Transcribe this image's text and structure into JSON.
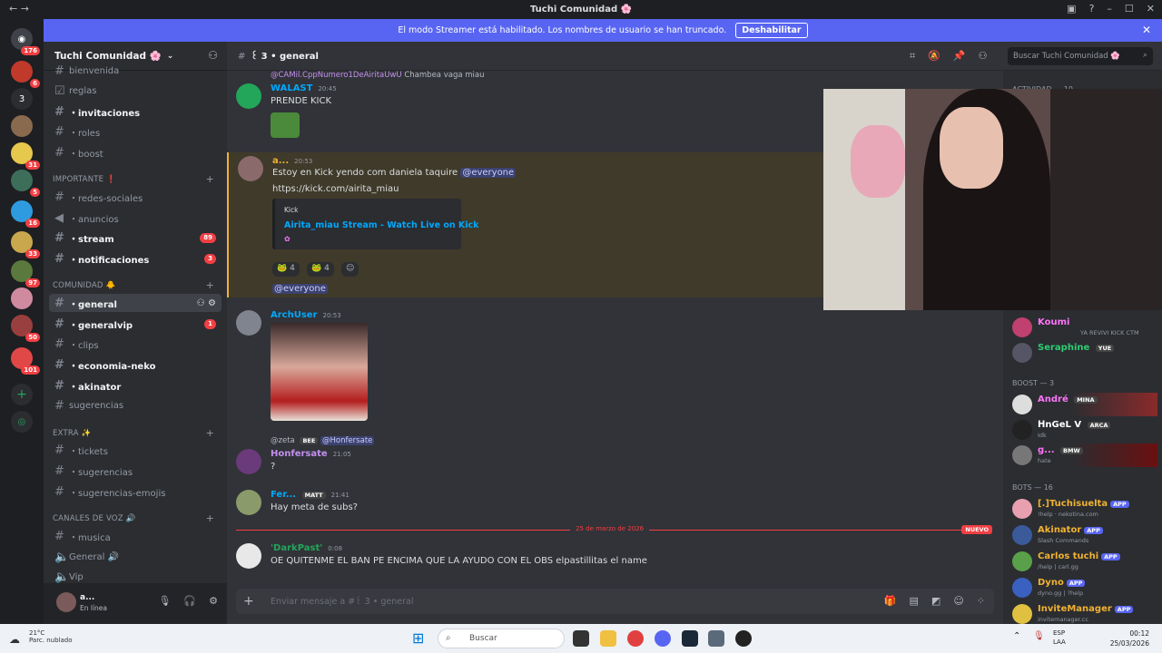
{
  "window": {
    "title": "Tuchi Comunidad 🌸"
  },
  "streamer_bar": {
    "message": "El modo Streamer está habilitado. Los nombres de usuario se han truncado.",
    "button": "Deshabilitar"
  },
  "guilds": [
    {
      "label": "",
      "badge": "176"
    },
    {
      "label": "",
      "badge": "6"
    },
    {
      "label": "3",
      "badge": ""
    },
    {
      "label": "",
      "badge": ""
    },
    {
      "label": "",
      "badge": "31"
    },
    {
      "label": "",
      "badge": "5"
    },
    {
      "label": "",
      "badge": "16"
    },
    {
      "label": "",
      "badge": "33"
    },
    {
      "label": "",
      "badge": "97"
    },
    {
      "label": "",
      "badge": ""
    },
    {
      "label": "",
      "badge": "50"
    },
    {
      "label": "",
      "badge": "101"
    }
  ],
  "server": {
    "name": "Tuchi Comunidad 🌸"
  },
  "channels": {
    "bienvenida": "bienvenida",
    "reglas": "reglas",
    "invitaciones": "・invitaciones",
    "roles": "・roles",
    "boost": "・boost",
    "cat_importante": "IMPORTANTE ❗",
    "redes_sociales": "・redes-sociales",
    "anuncios": "・anuncios",
    "stream": "・stream",
    "stream_badge": "89",
    "notificaciones": "・notificaciones",
    "notificaciones_badge": "3",
    "cat_comunidad": "COMUNIDAD 🐥",
    "general": "・general",
    "generalvip": "・generalvip",
    "generalvip_badge": "1",
    "clips": "・clips",
    "economia": "・economia-neko",
    "akinator": "・akinator",
    "sugerencias_plain": "sugerencias",
    "cat_extra": "EXTRA ✨",
    "tickets": "・tickets",
    "sugerencias": "・sugerencias",
    "sugerencias_emojis": "・sugerencias-emojis",
    "cat_voz": "CANALES DE VOZ 🔊",
    "musica": "・musica",
    "general_voice": "General 🔊",
    "vip": "Vip"
  },
  "user": {
    "name": "a...",
    "status": "En línea"
  },
  "header": {
    "channel": "꒰ 3 • general",
    "search_placeholder": "Buscar Tuchi Comunidad 🌸"
  },
  "messages": [
    {
      "reply_author": "@CAMil.CppNumero1DeAiritaUwU",
      "reply_text": "Chambea vaga miau",
      "author": "WALAST",
      "time": "20:45",
      "text": "PRENDE KICK"
    },
    {
      "author": "a...",
      "time": "20:53",
      "text": "Estoy en Kick yendo com daniela taquire",
      "mention": "@everyone",
      "link": "https://kick.com/airita_miau",
      "embed_provider": "Kick",
      "embed_title": "Airita_miau Stream - Watch Live on Kick",
      "react1": "4",
      "react2": "4",
      "followup": "@everyone"
    },
    {
      "author": "ArchUser",
      "time": "20:53"
    },
    {
      "reply_author": "@zeta",
      "reply_tag": "BEE",
      "reply_mention": "@Honfersate",
      "author": "Honfersate",
      "time": "21:05",
      "text": "?"
    },
    {
      "author": "Fer...",
      "tag": "MATT",
      "time": "21:41",
      "text": "Hay meta de subs?"
    },
    {
      "author": "'DarkPast'",
      "time": "0:08",
      "text": "OE QUITENME EL BAN PE ENCIMA QUE LA AYUDO CON EL OBS elpastillitas el name"
    }
  ],
  "divider": {
    "date": "25 de marzo de 2026",
    "new_label": "NUEVO"
  },
  "composer": {
    "placeholder": "Enviar mensaje a #꒰ 3 • general"
  },
  "members": {
    "activity": "Actividad — 10",
    "online": [
      {
        "name": "Koumi",
        "status": "YA REVIVI KICK CTM",
        "color": "#ff73fa"
      },
      {
        "name": "Seraphine",
        "status": "",
        "color": "#2ecc71",
        "tag": "YUE"
      }
    ],
    "boost_label": "BOOST — 3",
    "boost": [
      {
        "name": "André",
        "tag": "MINA",
        "status": "",
        "color": "#ff73fa"
      },
      {
        "name": "ᕼnGeL V",
        "tag": "ARCA",
        "status": "Idk",
        "color": "#ffffff"
      },
      {
        "name": "g...",
        "tag": "BMW",
        "status": "hate",
        "color": "#ff73fa"
      }
    ],
    "bots_label": "BOTS — 16",
    "bots": [
      {
        "name": "[.]Tuchisuelta",
        "tag": "APP",
        "status": "!help · nekotina.com",
        "color": "#f0b232"
      },
      {
        "name": "Akinator",
        "tag": "APP",
        "status": "Slash Commands",
        "color": "#f0b232"
      },
      {
        "name": "Carlos tuchi",
        "tag": "APP",
        "status": "/help | carl.gg",
        "color": "#f0b232"
      },
      {
        "name": "Dyno",
        "tag": "APP",
        "status": "dyno.gg | ?help",
        "color": "#f0b232"
      },
      {
        "name": "InviteManager",
        "tag": "APP",
        "status": "invitemanager.cc",
        "color": "#f0b232"
      }
    ]
  },
  "taskbar": {
    "weather_temp": "21°C",
    "weather_desc": "Parc. nublado",
    "search": "Buscar",
    "lang1": "ESP",
    "lang2": "LAA",
    "time": "00:12",
    "date": "25/03/2026"
  }
}
